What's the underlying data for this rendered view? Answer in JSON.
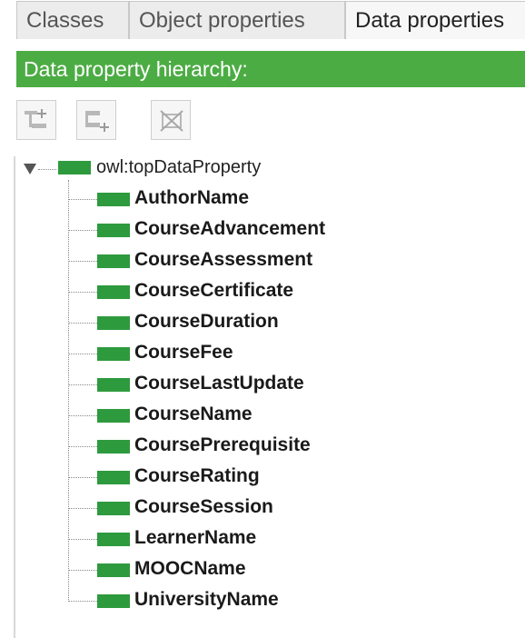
{
  "tabs": [
    {
      "label": "Classes"
    },
    {
      "label": "Object properties"
    },
    {
      "label": "Data properties"
    }
  ],
  "panel": {
    "title": "Data property hierarchy:"
  },
  "toolbar": {
    "buttons": [
      {
        "icon": "add-subproperty-icon"
      },
      {
        "icon": "add-sibling-property-icon"
      },
      {
        "icon": "delete-property-icon"
      }
    ]
  },
  "tree": {
    "root": {
      "label": "owl:topDataProperty",
      "expanded": true
    },
    "items": [
      {
        "label": "AuthorName"
      },
      {
        "label": "CourseAdvancement"
      },
      {
        "label": "CourseAssessment"
      },
      {
        "label": "CourseCertificate"
      },
      {
        "label": "CourseDuration"
      },
      {
        "label": "CourseFee"
      },
      {
        "label": "CourseLastUpdate"
      },
      {
        "label": "CourseName"
      },
      {
        "label": "CoursePrerequisite"
      },
      {
        "label": "CourseRating"
      },
      {
        "label": "CourseSession"
      },
      {
        "label": "LearnerName"
      },
      {
        "label": "MOOCName"
      },
      {
        "label": "UniversityName"
      }
    ]
  },
  "colors": {
    "header_green": "#4cac44",
    "property_green": "#2e9a3e"
  }
}
